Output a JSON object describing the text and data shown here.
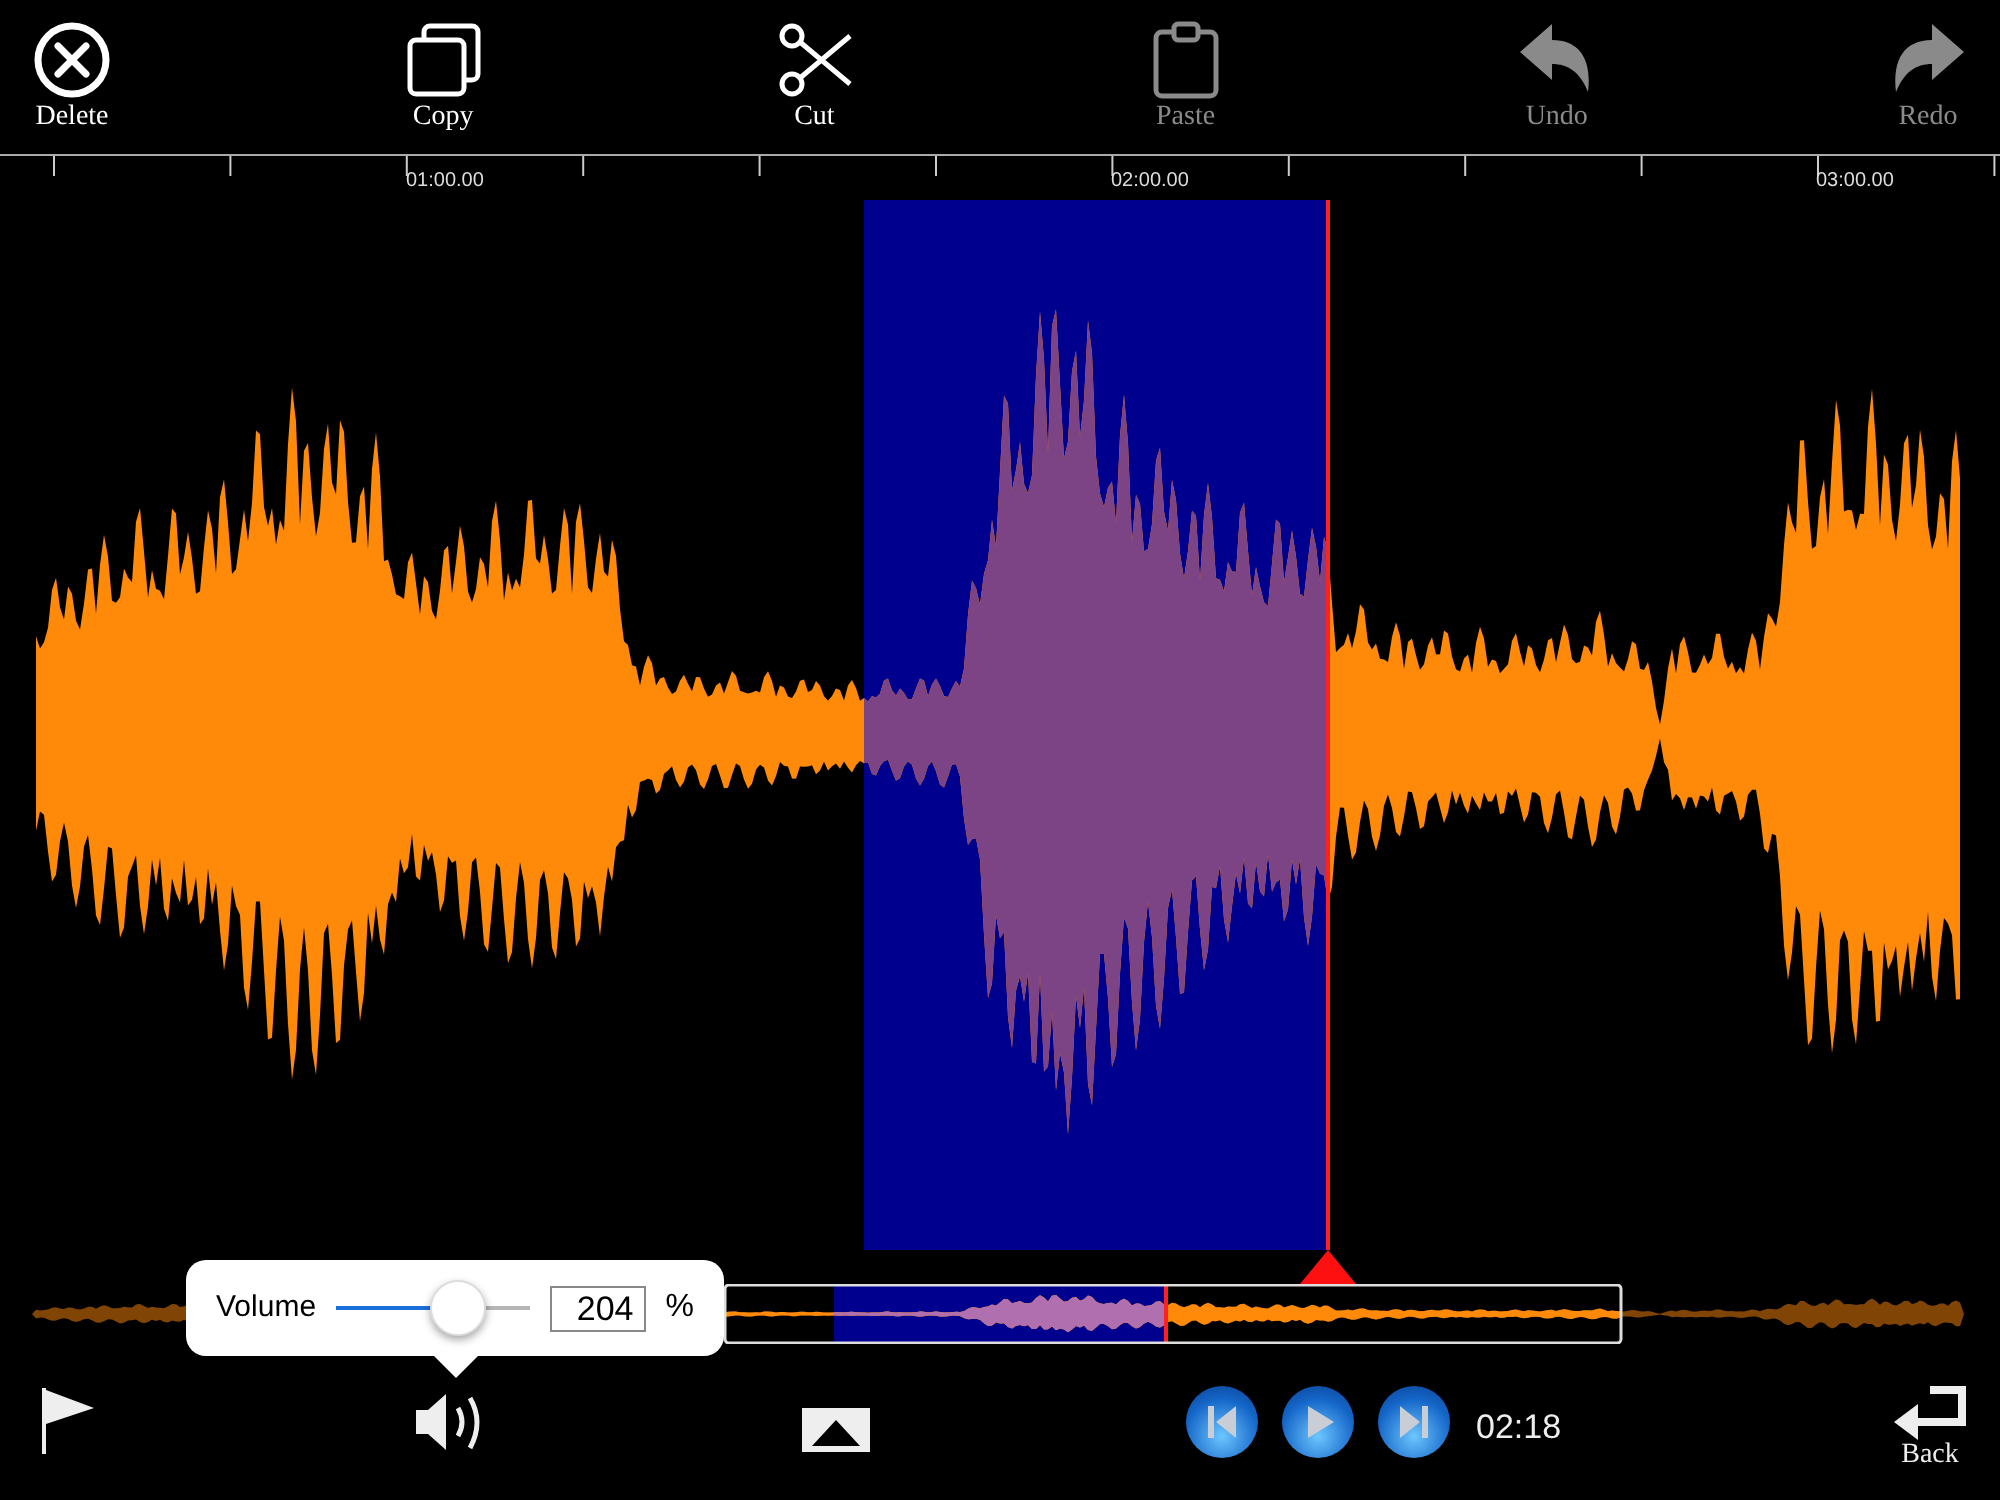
{
  "toolbar": [
    {
      "kind": "delete",
      "label": "Delete",
      "disabled": false
    },
    {
      "kind": "copy",
      "label": "Copy",
      "disabled": false
    },
    {
      "kind": "cut",
      "label": "Cut",
      "disabled": false
    },
    {
      "kind": "paste",
      "label": "Paste",
      "disabled": true
    },
    {
      "kind": "undo",
      "label": "Undo",
      "disabled": true
    },
    {
      "kind": "redo",
      "label": "Redo",
      "disabled": true
    }
  ],
  "ruler": {
    "labels": [
      "01:00.00",
      "02:00.00",
      "03:00.00"
    ]
  },
  "volume_popup": {
    "label": "Volume",
    "level": 0.63,
    "value": "204",
    "unit": "%"
  },
  "transport": {
    "time": "02:18"
  },
  "back": {
    "label": "Back"
  }
}
